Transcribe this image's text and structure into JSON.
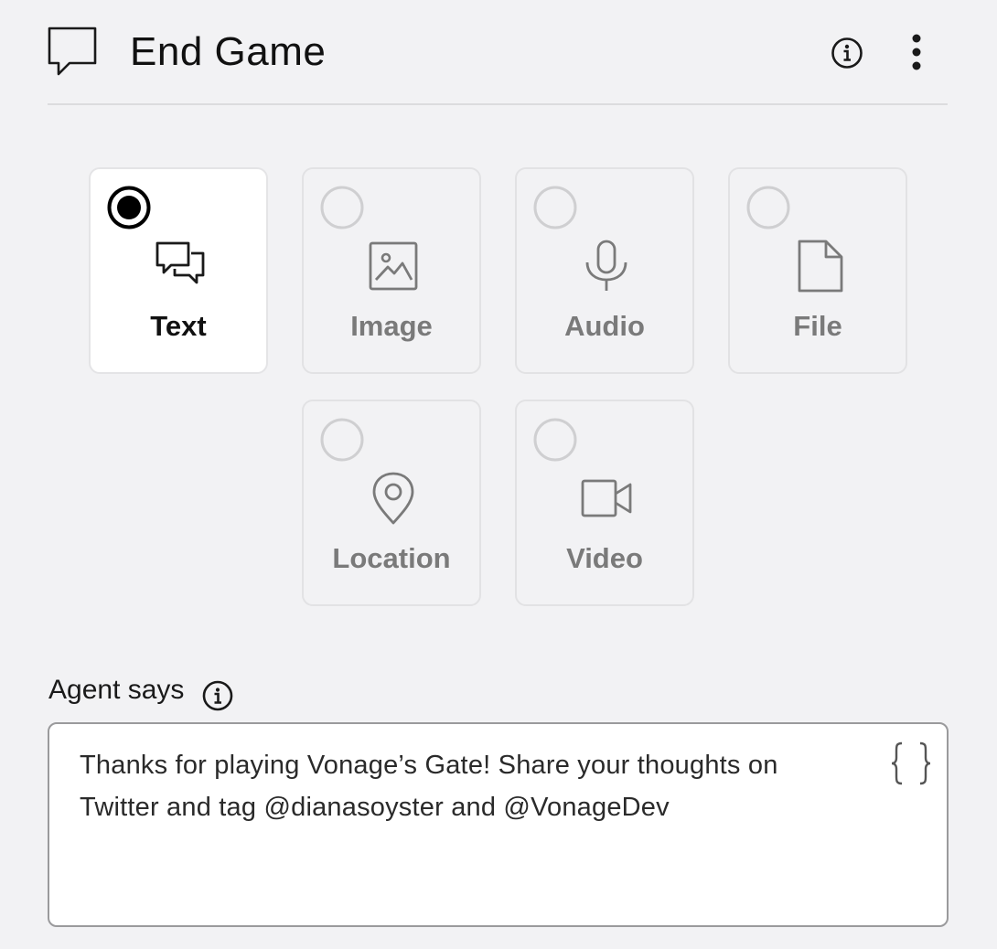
{
  "header": {
    "title": "End Game",
    "icon": "speech-bubble-icon",
    "info_icon": "info-icon",
    "more_icon": "more-vertical-icon"
  },
  "message_types": [
    {
      "label": "Text",
      "icon": "chat-bubbles-icon",
      "selected": true
    },
    {
      "label": "Image",
      "icon": "image-icon",
      "selected": false
    },
    {
      "label": "Audio",
      "icon": "microphone-icon",
      "selected": false
    },
    {
      "label": "File",
      "icon": "file-icon",
      "selected": false
    },
    {
      "label": "Location",
      "icon": "location-pin-icon",
      "selected": false
    },
    {
      "label": "Video",
      "icon": "video-camera-icon",
      "selected": false
    }
  ],
  "agent_says": {
    "label": "Agent says",
    "info_icon": "info-icon",
    "text": "Thanks for playing Vonage’s Gate! Share your thoughts on Twitter and tag @dianasoyster and @VonageDev",
    "variable_icon": "curly-braces-icon"
  },
  "colors": {
    "background": "#f2f2f4",
    "selected_card": "#ffffff",
    "muted_text": "#7a7a7a",
    "text": "#111111"
  }
}
